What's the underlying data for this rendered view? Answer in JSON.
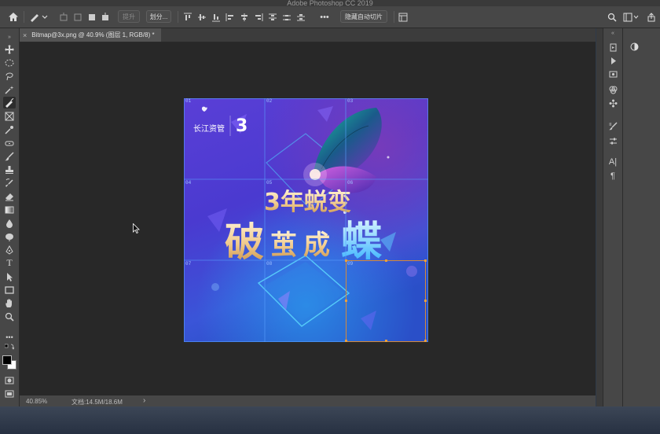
{
  "app": {
    "title": "Adobe Photoshop CC 2019"
  },
  "options_bar": {
    "promote_label": "提升",
    "divide_label": "划分...",
    "more_label": "•••",
    "hide_auto_slices_label": "隐藏自动切片"
  },
  "document_tab": {
    "label": "Bitmap@3x.png @ 40.9% (图层 1, RGB/8) *",
    "close": "×"
  },
  "status_bar": {
    "zoom": "40.85%",
    "doc_info": "文档:14.5M/18.6M",
    "arrow": "›"
  },
  "artwork": {
    "headline_line1": "3年蜕变",
    "headline_line2_chars": [
      "破",
      "茧",
      "成",
      "蝶"
    ],
    "logo_text": "长江资管",
    "slice_labels": [
      "01",
      "02",
      "03",
      "04",
      "05",
      "06",
      "07",
      "08",
      "09"
    ]
  },
  "colors": {
    "app_bg": "#474747",
    "workspace": "#282828",
    "slice_line": "#5aa0ff",
    "active_slice": "#d48a3a",
    "art_purple": "#5b3fd8",
    "art_blue": "#2b7bd6"
  },
  "icons": {
    "tools": [
      "move-icon",
      "marquee-icon",
      "lasso-icon",
      "quick-select-icon",
      "slice-icon",
      "frame-icon",
      "crop-icon",
      "eyedropper-icon",
      "healing-icon",
      "brush-icon",
      "stamp-icon",
      "history-brush-icon",
      "eraser-icon",
      "gradient-icon",
      "blur-icon",
      "dodge-icon",
      "pen-icon",
      "type-icon",
      "path-select-icon",
      "rectangle-icon",
      "hand-icon",
      "zoom-icon",
      "more-tools-icon"
    ]
  }
}
